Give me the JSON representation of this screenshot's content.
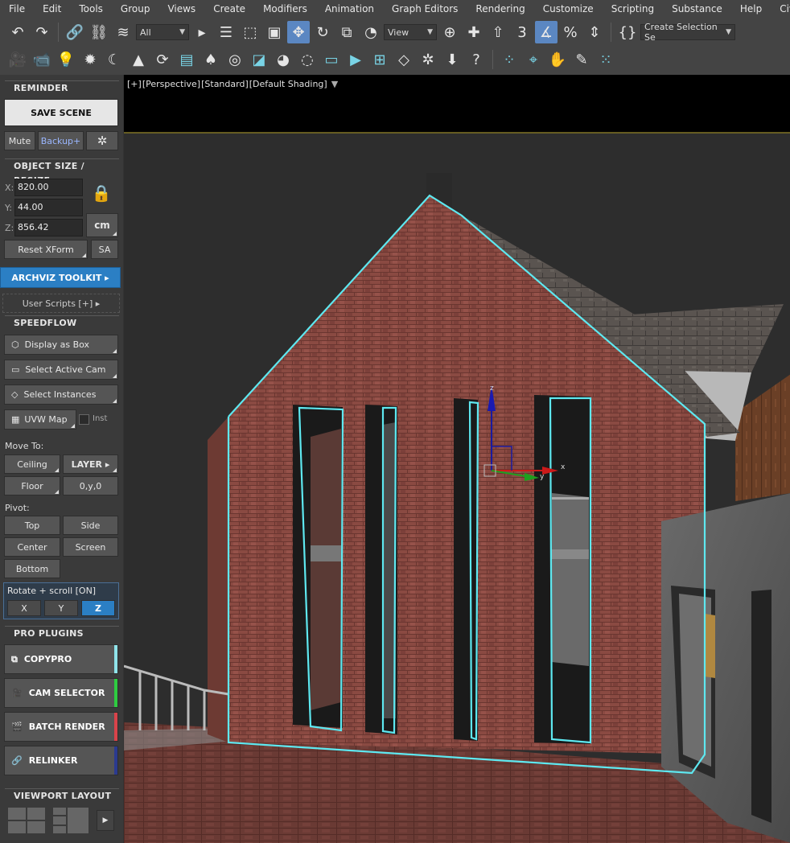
{
  "menu": [
    "File",
    "Edit",
    "Tools",
    "Group",
    "Views",
    "Create",
    "Modifiers",
    "Animation",
    "Graph Editors",
    "Rendering",
    "Customize",
    "Scripting",
    "Substance",
    "Help",
    "CivilV"
  ],
  "toolbar": {
    "selection_filter": "All",
    "ref_coord": "View",
    "selection_set": "Create Selection Se",
    "snap_number": "3",
    "icons": [
      "undo-icon",
      "redo-icon",
      "link-icon",
      "unlink-icon",
      "bind-spacewarp-icon",
      "select-object-icon",
      "select-by-name-icon",
      "rect-selection-icon",
      "window-crossing-icon",
      "move-icon",
      "rotate-icon",
      "scale-icon",
      "placement-icon",
      "use-pivot-icon",
      "mirror-icon",
      "align-icon",
      "snap-toggle-icon",
      "angle-snap-icon",
      "percent-snap-icon",
      "spinner-snap-icon",
      "named-sets-icon"
    ]
  },
  "toolbar2_icons": [
    "camera-icon",
    "render-camera-icon",
    "light-bulb-icon",
    "sun-icon",
    "moon-icon",
    "tree-icon",
    "reset-icon",
    "list-icon",
    "forest-icon",
    "ring-icon",
    "material-icon",
    "palette-icon",
    "bulb2-icon",
    "frame-icon",
    "play-frame-icon",
    "safe-frame-icon",
    "fish-icon",
    "aperture-icon",
    "download-icon",
    "help-icon",
    "pivot-dots-icon",
    "target-icon",
    "hand-icon",
    "brush-icon",
    "grid-dots-icon"
  ],
  "left_panel": {
    "reminder": {
      "title": "REMINDER",
      "save_label": "SAVE SCENE",
      "mute_label": "Mute",
      "backup_label": "Backup+"
    },
    "object_size": {
      "title": "OBJECT SIZE / RESIZE",
      "x_label": "X:",
      "x_value": "820.00",
      "y_label": "Y:",
      "y_value": "44.00",
      "z_label": "Z:",
      "z_value": "856.42",
      "unit": "cm",
      "reset_xform": "Reset XForm",
      "sa": "SA"
    },
    "archviz": "ARCHVIZ TOOLKIT ▸",
    "user_scripts": "User Scripts [+] ▸",
    "speedflow": {
      "title": "SPEEDFLOW",
      "display_as_box": "Display as Box",
      "select_active_cam": "Select Active Cam",
      "select_instances": "Select Instances",
      "uvw_map": "UVW Map",
      "inst": "Inst",
      "move_to": "Move To:",
      "ceiling": "Ceiling",
      "layer": "LAYER ▸",
      "floor": "Floor",
      "zero": "0,y,0",
      "pivot": "Pivot:",
      "top": "Top",
      "side": "Side",
      "center": "Center",
      "screen": "Screen",
      "bottom": "Bottom",
      "rotate_scroll": "Rotate + scroll  [ON]",
      "axis_x": "X",
      "axis_y": "Y",
      "axis_z": "Z"
    },
    "pro_plugins": {
      "title": "PRO PLUGINS",
      "items": [
        {
          "label": "COPYPRO",
          "color": "#8fe3ea"
        },
        {
          "label": "CAM SELECTOR",
          "color": "#2ecc40"
        },
        {
          "label": "BATCH RENDER",
          "color": "#d9434a"
        },
        {
          "label": "RELINKER",
          "color": "#2b3a8f"
        }
      ]
    },
    "viewport_layout": {
      "title": "VIEWPORT LAYOUT"
    }
  },
  "viewport": {
    "labels": [
      "[+]",
      "[Perspective]",
      "[Standard]",
      "[Default Shading]"
    ],
    "gizmo_x": "x",
    "gizmo_y": "y",
    "gizmo_z": "z"
  },
  "colors": {
    "selection": "#5ee8f0",
    "brick": "#8a4a42",
    "active_blue": "#2b7fc4"
  }
}
